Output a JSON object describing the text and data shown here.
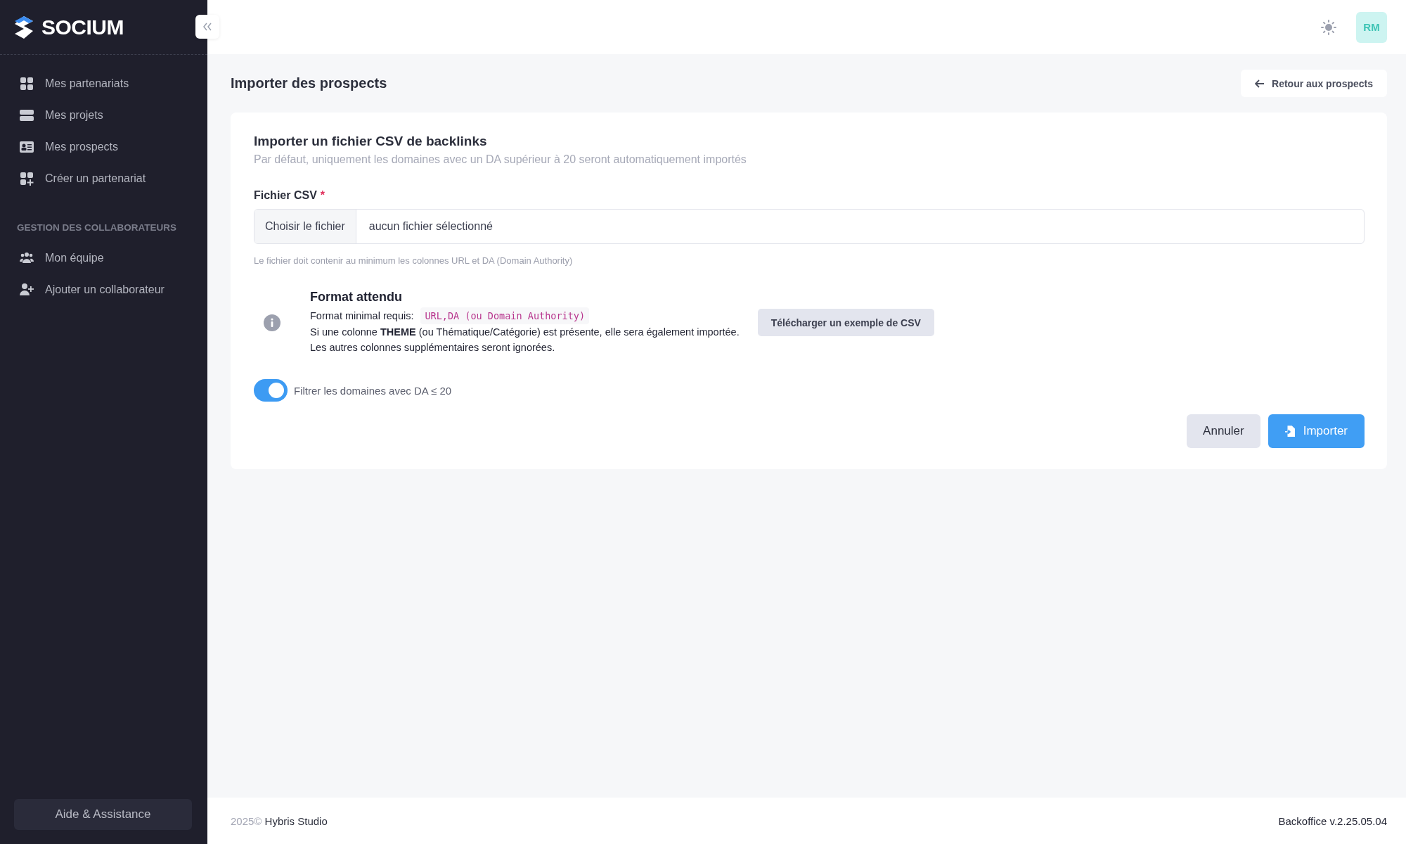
{
  "sidebar": {
    "logo": "SOCIUM",
    "items": [
      {
        "label": "Mes partenariats",
        "kind": "grid",
        "selected": false
      },
      {
        "label": "Mes projets",
        "kind": "server",
        "selected": false
      },
      {
        "label": "Mes prospects",
        "kind": "card",
        "selected": false
      },
      {
        "label": "Créer un partenariat",
        "kind": "grid-plus",
        "selected": false
      }
    ],
    "section": {
      "title": "GESTION DES COLLABORATEURS",
      "items": [
        {
          "label": "Mon équipe",
          "kind": "users",
          "selected": false
        },
        {
          "label": "Ajouter un collaborateur",
          "kind": "user-plus",
          "selected": false
        }
      ]
    },
    "help_button": "Aide & Assistance"
  },
  "header": {
    "avatar": "RM"
  },
  "page": {
    "title": "Importer des prospects",
    "back_button": "Retour aux prospects"
  },
  "card": {
    "title": "Importer un fichier CSV de backlinks",
    "subtitle": "Par défaut, uniquement les domaines avec un DA supérieur à 20 seront automatiquement importés",
    "field": {
      "label": "Fichier CSV",
      "required_mark": "*",
      "button": "Choisir le fichier",
      "value": "aucun fichier sélectionné",
      "help": "Le fichier doit contenir au minimum les colonnes URL et DA (Domain Authority)"
    },
    "format": {
      "title": "Format attendu",
      "label": "Format minimal requis:",
      "code": "URL,DA (ou Domain Authority)",
      "lines": [
        "Si une colonne **THEME** (ou Thématique/Catégorie) est présente, elle sera également importée.",
        "Les autres colonnes supplémentaires seront ignorées."
      ],
      "download_button": "Télécharger un exemple de CSV"
    },
    "toggle": {
      "label": "Filtrer les domaines avec DA ≤ 20",
      "on": true
    },
    "buttons": {
      "cancel": "Annuler",
      "submit": "Importer"
    }
  },
  "footer": {
    "year": "2025©",
    "company": "Hybris Studio",
    "version": "Backoffice v.2.25.05.04"
  }
}
